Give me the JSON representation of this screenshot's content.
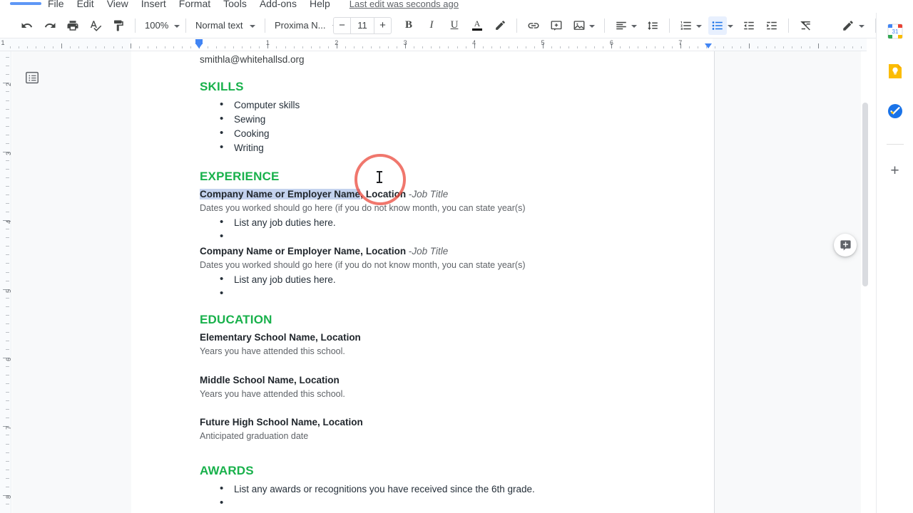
{
  "menu": {
    "items": [
      "File",
      "Edit",
      "View",
      "Insert",
      "Format",
      "Tools",
      "Add-ons",
      "Help"
    ],
    "last_edit": "Last edit was seconds ago"
  },
  "toolbar": {
    "undo": "undo-icon",
    "redo": "redo-icon",
    "print": "print-icon",
    "spellcheck": "spellcheck-icon",
    "paint_format": "paint-format-icon",
    "zoom_value": "100%",
    "style_value": "Normal text",
    "font_value": "Proxima N...",
    "font_size": "11",
    "minus": "−",
    "plus": "+",
    "bold": "B",
    "italic": "I",
    "underline": "U",
    "text_color": "A",
    "highlight": "highlight-icon",
    "link": "link-icon",
    "comment": "add-comment-icon",
    "image": "insert-image-icon",
    "align": "align-left-icon",
    "line_spacing": "line-spacing-icon",
    "numbered_list": "numbered-list-icon",
    "bulleted_list": "bulleted-list-icon",
    "decrease_indent": "decrease-indent-icon",
    "increase_indent": "increase-indent-icon",
    "clear_formatting": "clear-formatting-icon",
    "editing_mode": "editing-mode-pencil-icon",
    "hide_menus": "hide-menus-chevron-icon",
    "active_tool": "bulleted_list"
  },
  "ruler": {
    "h_numbers": [
      "1",
      "2",
      "3",
      "4",
      "5",
      "6",
      "7"
    ],
    "v_numbers": [
      "2",
      "3",
      "4",
      "5",
      "6",
      "7",
      "8"
    ]
  },
  "gutter": {
    "outline_toggle": "document-outline-icon"
  },
  "document": {
    "email": "smithla@whitehallsd.org",
    "sections": {
      "skills": {
        "heading": "SKILLS",
        "items": [
          "Computer skills",
          "Sewing",
          "Cooking",
          "Writing"
        ]
      },
      "experience": {
        "heading": "EXPERIENCE",
        "entries": [
          {
            "company_selected": "Company Name or Employer Name",
            "company_tail": ",",
            "location": "Location",
            "separator": "-",
            "job_title": "Job Title",
            "dates": "Dates you worked should go here (if you do not know month, you can state year(s)",
            "duties": [
              "List any job duties here.",
              ""
            ]
          },
          {
            "company_selected": "Company Name or Employer Name",
            "company_tail": ",",
            "location": "Location",
            "separator": "-",
            "job_title": "Job Title",
            "dates": "Dates you worked should go here (if you do not know month, you can state year(s)",
            "duties": [
              "List any job duties here.",
              ""
            ]
          }
        ]
      },
      "education": {
        "heading": "EDUCATION",
        "entries": [
          {
            "name": "Elementary School Name, Location",
            "sub": "Years you have attended this school."
          },
          {
            "name": "Middle School Name, Location",
            "sub": "Years you have attended this school."
          },
          {
            "name": "Future High School Name, Location",
            "sub": "Anticipated graduation date"
          }
        ]
      },
      "awards": {
        "heading": "AWARDS",
        "items": [
          "List any awards or recognitions you have received since the 6th grade.",
          ""
        ]
      }
    }
  },
  "rail": {
    "calendar": "google-calendar-icon",
    "calendar_day": "31",
    "keep": "google-keep-icon",
    "tasks": "google-tasks-icon",
    "add": "+"
  },
  "colors": {
    "heading_green": "#18b14b",
    "selection_blue": "#c4d2ee",
    "accent_blue": "#1a73e8",
    "cursor_ring_red": "#ea4335"
  }
}
